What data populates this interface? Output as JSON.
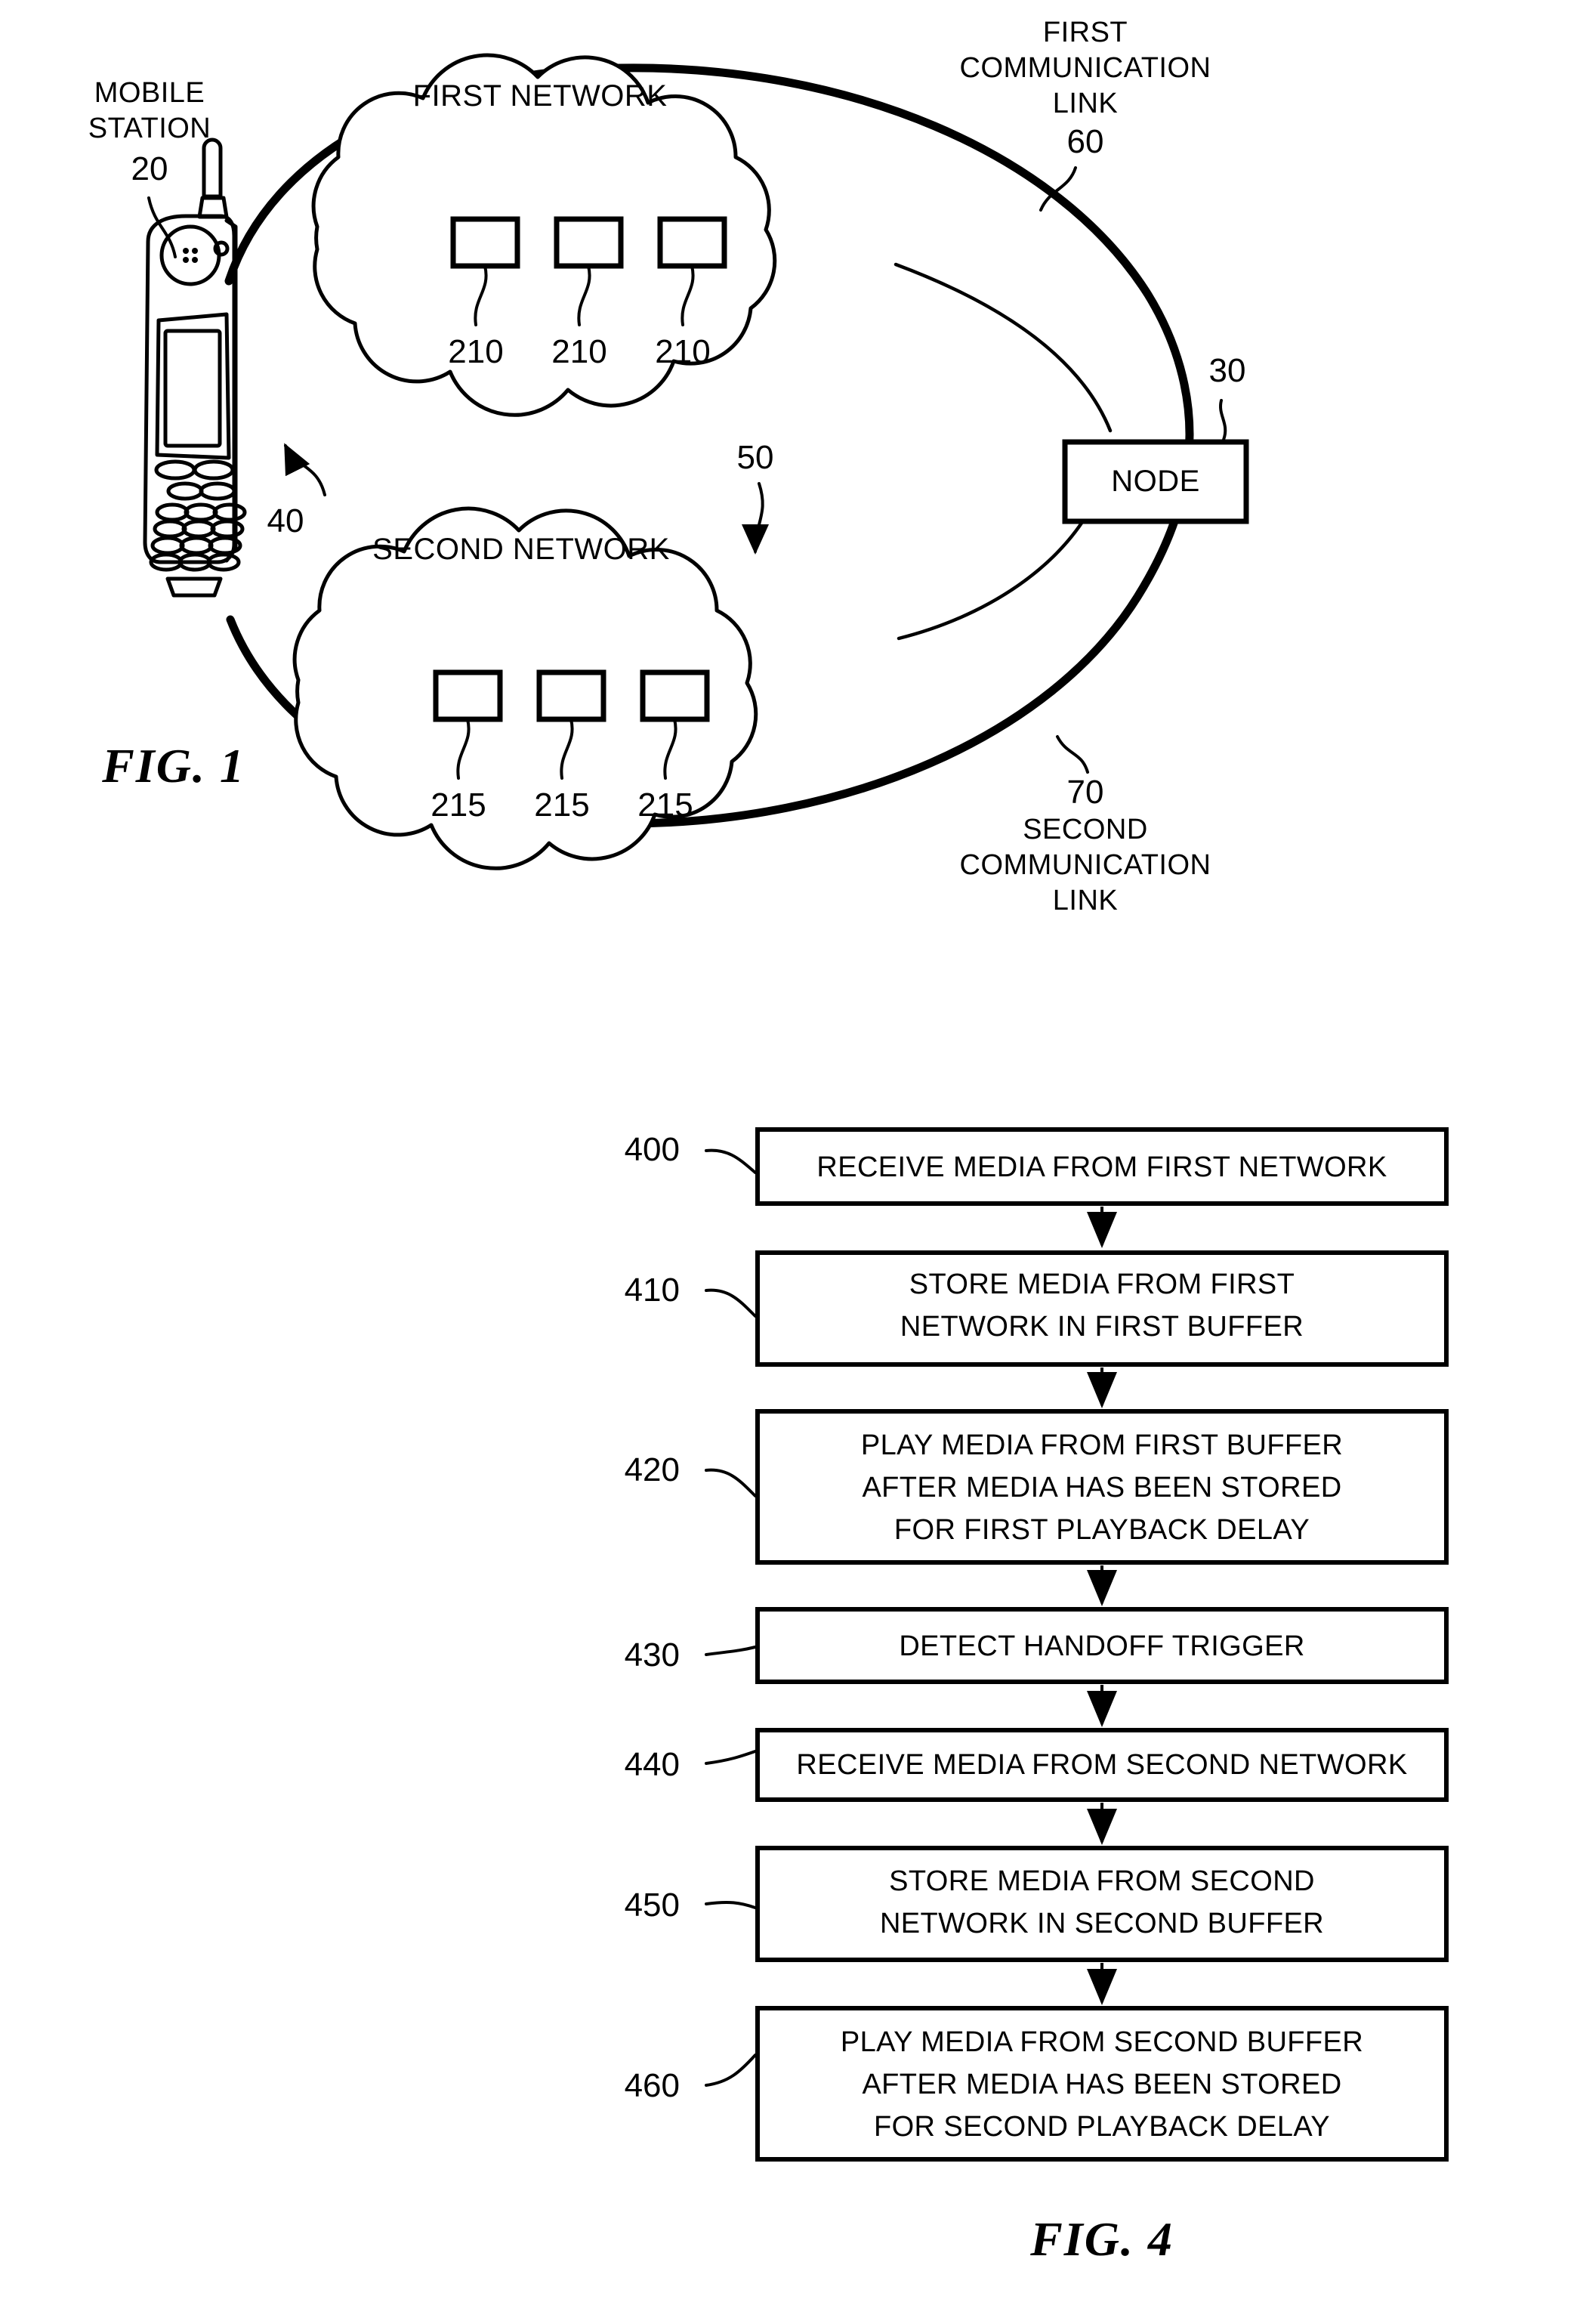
{
  "figure1": {
    "label": "FIG. 1",
    "mobile_station": {
      "title_line1": "MOBILE",
      "title_line2": "STATION",
      "ref": "20"
    },
    "first_network": {
      "label": "FIRST NETWORK",
      "ref": "40",
      "node_refs": [
        "210",
        "210",
        "210"
      ]
    },
    "second_network": {
      "label": "SECOND NETWORK",
      "ref": "50",
      "node_refs": [
        "215",
        "215",
        "215"
      ]
    },
    "node": {
      "label": "NODE",
      "ref": "30"
    },
    "first_link": {
      "line1": "FIRST",
      "line2": "COMMUNICATION",
      "line3": "LINK",
      "ref": "60"
    },
    "second_link": {
      "ref": "70",
      "line1": "SECOND",
      "line2": "COMMUNICATION",
      "line3": "LINK"
    }
  },
  "figure4": {
    "label": "FIG. 4",
    "steps": [
      {
        "ref": "400",
        "lines": [
          "RECEIVE MEDIA FROM FIRST NETWORK"
        ]
      },
      {
        "ref": "410",
        "lines": [
          "STORE MEDIA FROM FIRST",
          "NETWORK IN FIRST BUFFER"
        ]
      },
      {
        "ref": "420",
        "lines": [
          "PLAY MEDIA FROM FIRST BUFFER",
          "AFTER MEDIA HAS BEEN STORED",
          "FOR FIRST PLAYBACK DELAY"
        ]
      },
      {
        "ref": "430",
        "lines": [
          "DETECT HANDOFF TRIGGER"
        ]
      },
      {
        "ref": "440",
        "lines": [
          "RECEIVE MEDIA FROM SECOND NETWORK"
        ]
      },
      {
        "ref": "450",
        "lines": [
          "STORE MEDIA FROM SECOND",
          "NETWORK IN SECOND BUFFER"
        ]
      },
      {
        "ref": "460",
        "lines": [
          "PLAY MEDIA FROM SECOND BUFFER",
          "AFTER MEDIA HAS BEEN STORED",
          "FOR SECOND PLAYBACK DELAY"
        ]
      }
    ]
  },
  "colors": {
    "ink": "#000000",
    "paper": "#ffffff"
  }
}
